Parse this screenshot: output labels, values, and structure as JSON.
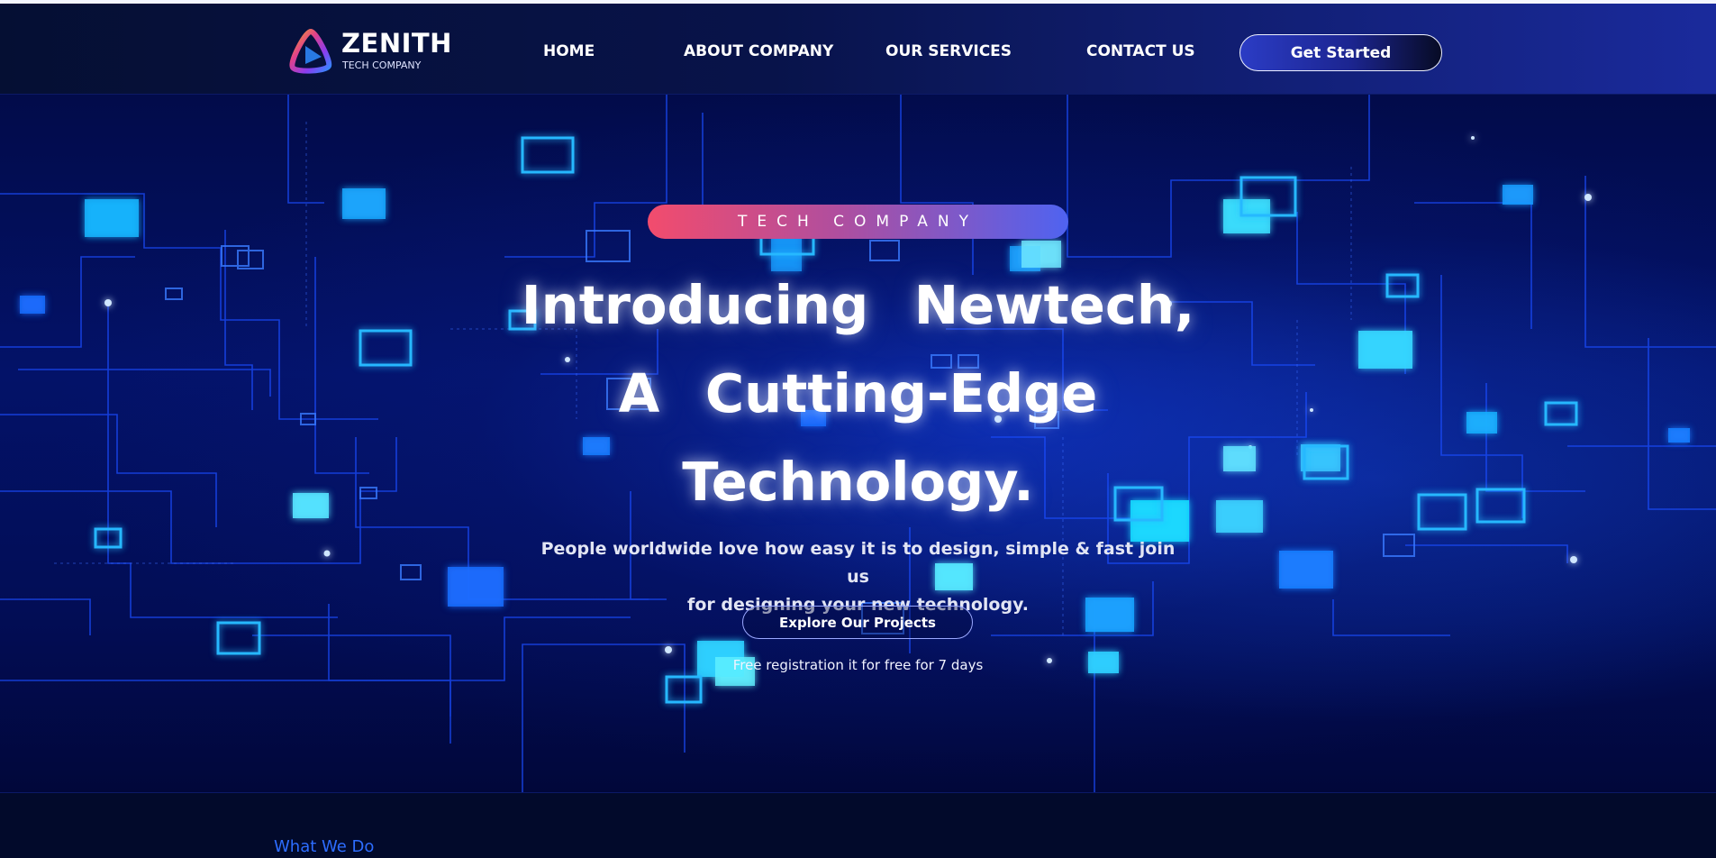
{
  "brand": {
    "name": "ZENITH",
    "tagline": "TECH COMPANY",
    "colors": {
      "logo_gradient": [
        "#f5a524",
        "#e0418a",
        "#8a3cf0",
        "#2f8cff"
      ]
    }
  },
  "nav": {
    "items": [
      {
        "label": "HOME"
      },
      {
        "label": "ABOUT COMPANY"
      },
      {
        "label": "OUR SERVICES"
      },
      {
        "label": "CONTACT US"
      }
    ],
    "cta_label": "Get Started"
  },
  "hero": {
    "badge": "TECH COMPANY",
    "headline_lines": [
      "Introducing Newtech,",
      "A Cutting-Edge",
      "Technology."
    ],
    "subtitle_lines": [
      "People worldwide love how easy it is to design, simple & fast join us",
      "for designing your new technology."
    ],
    "button_label": "Explore Our Projects",
    "note": "Free registration it for free for 7 days",
    "background": "circuit-board-illustration",
    "colors": {
      "accent": "#1a5cff",
      "badge_start": "#f24c6d",
      "badge_end": "#4f63f0",
      "glow": "#22c6ff"
    }
  },
  "next_section": {
    "label": "What We Do"
  }
}
